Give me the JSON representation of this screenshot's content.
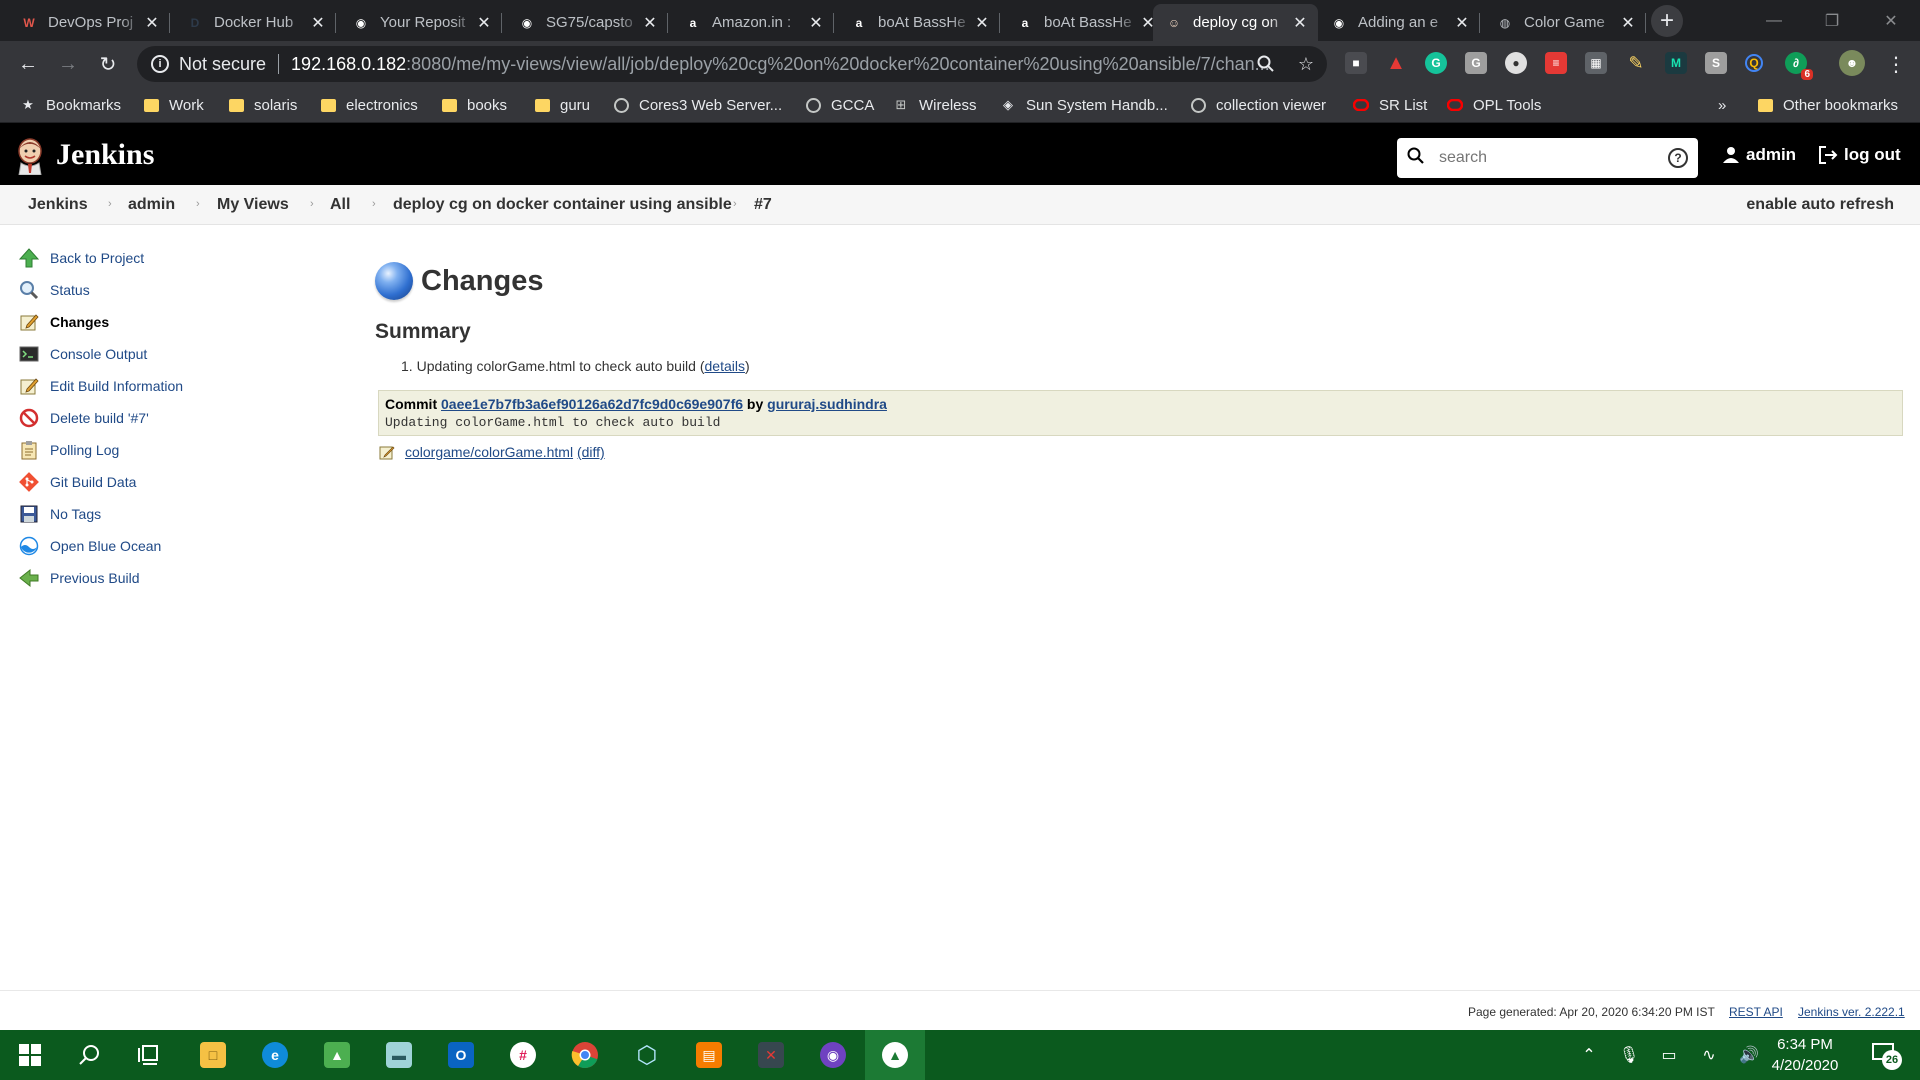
{
  "browser": {
    "tabs": [
      {
        "title": "DevOps Proj",
        "icon": "jira-icon",
        "color": "#e2574c",
        "glyph": "W"
      },
      {
        "title": "Docker Hub",
        "icon": "docker-icon",
        "color": "#2d3a4a",
        "glyph": "D"
      },
      {
        "title": "Your Reposit",
        "icon": "github-icon",
        "color": "#ffffff",
        "glyph": "◉"
      },
      {
        "title": "SG75/capsto",
        "icon": "github-icon",
        "color": "#ffffff",
        "glyph": "◉"
      },
      {
        "title": "Amazon.in :",
        "icon": "amazon-icon",
        "color": "#ffffff",
        "glyph": "a"
      },
      {
        "title": "boAt BassHe",
        "icon": "amazon-icon",
        "color": "#ffffff",
        "glyph": "a"
      },
      {
        "title": "boAt BassHe",
        "icon": "amazon-icon",
        "color": "#ffffff",
        "glyph": "a"
      },
      {
        "title": "deploy cg on",
        "icon": "jenkins-icon",
        "color": "#f3d9c4",
        "glyph": "☺"
      },
      {
        "title": "Adding an e",
        "icon": "github-icon",
        "color": "#ffffff",
        "glyph": "◉"
      },
      {
        "title": "Color Game",
        "icon": "globe-icon",
        "color": "#bdc1c6",
        "glyph": "◍"
      }
    ],
    "new_tab": "+",
    "url": {
      "security": "Not secure",
      "host": "192.168.0.182",
      "path": ":8080/me/my-views/view/all/job/deploy%20cg%20on%20docker%20container%20using%20ansible/7/chan..."
    },
    "bookmarks": [
      {
        "label": "Bookmarks",
        "icon": "star-icon"
      },
      {
        "label": "Work",
        "icon": "folder-icon"
      },
      {
        "label": "solaris",
        "icon": "folder-icon"
      },
      {
        "label": "electronics",
        "icon": "folder-icon"
      },
      {
        "label": "books",
        "icon": "folder-icon"
      },
      {
        "label": "guru",
        "icon": "folder-icon"
      },
      {
        "label": "Cores3 Web Server...",
        "icon": "globe-icon"
      },
      {
        "label": "GCCA",
        "icon": "globe-icon"
      },
      {
        "label": "Wireless",
        "icon": "network-icon"
      },
      {
        "label": "Sun System Handb...",
        "icon": "sun-icon"
      },
      {
        "label": "collection viewer",
        "icon": "globe-icon"
      },
      {
        "label": "SR List",
        "icon": "oracle-icon"
      },
      {
        "label": "OPL Tools",
        "icon": "oracle-icon"
      }
    ],
    "bookmarks_overflow": "»",
    "other_bookmarks": "Other bookmarks",
    "extension_badge": "6"
  },
  "jenkins": {
    "title": "Jenkins",
    "search_placeholder": "search",
    "user": "admin",
    "logout": "log out",
    "breadcrumbs": [
      "Jenkins",
      "admin",
      "My Views",
      "All",
      "deploy cg on docker container using ansible",
      "#7"
    ],
    "auto_refresh": "enable auto refresh",
    "tasks": [
      {
        "label": "Back to Project",
        "icon": "up-arrow-icon"
      },
      {
        "label": "Status",
        "icon": "magnifier-icon"
      },
      {
        "label": "Changes",
        "icon": "notepad-icon"
      },
      {
        "label": "Console Output",
        "icon": "terminal-icon"
      },
      {
        "label": "Edit Build Information",
        "icon": "notepad-icon"
      },
      {
        "label": "Delete build '#7'",
        "icon": "no-entry-icon"
      },
      {
        "label": "Polling Log",
        "icon": "clipboard-icon"
      },
      {
        "label": "Git Build Data",
        "icon": "git-icon"
      },
      {
        "label": "No Tags",
        "icon": "save-icon"
      },
      {
        "label": "Open Blue Ocean",
        "icon": "blue-ocean-icon"
      },
      {
        "label": "Previous Build",
        "icon": "left-arrow-icon"
      }
    ],
    "page_title": "Changes",
    "summary_heading": "Summary",
    "summary_items": [
      {
        "number": "1.",
        "text": "Updating colorGame.html to check auto build",
        "link": "details"
      }
    ],
    "commit": {
      "label": "Commit",
      "hash": "0aee1e7b7fb3a6ef90126a62d7fc9d0c69e907f6",
      "by": "by",
      "author": "gururaj.sudhindra",
      "message": "Updating colorGame.html to check auto build"
    },
    "files": [
      {
        "path": "colorgame/colorGame.html",
        "diff": "(diff)"
      }
    ],
    "footer": {
      "generated": "Page generated: Apr 20, 2020 6:34:20 PM IST",
      "rest_api": "REST API",
      "version": "Jenkins ver. 2.222.1"
    }
  },
  "taskbar": {
    "time": "6:34 PM",
    "date": "4/20/2020",
    "notification_count": "26"
  }
}
